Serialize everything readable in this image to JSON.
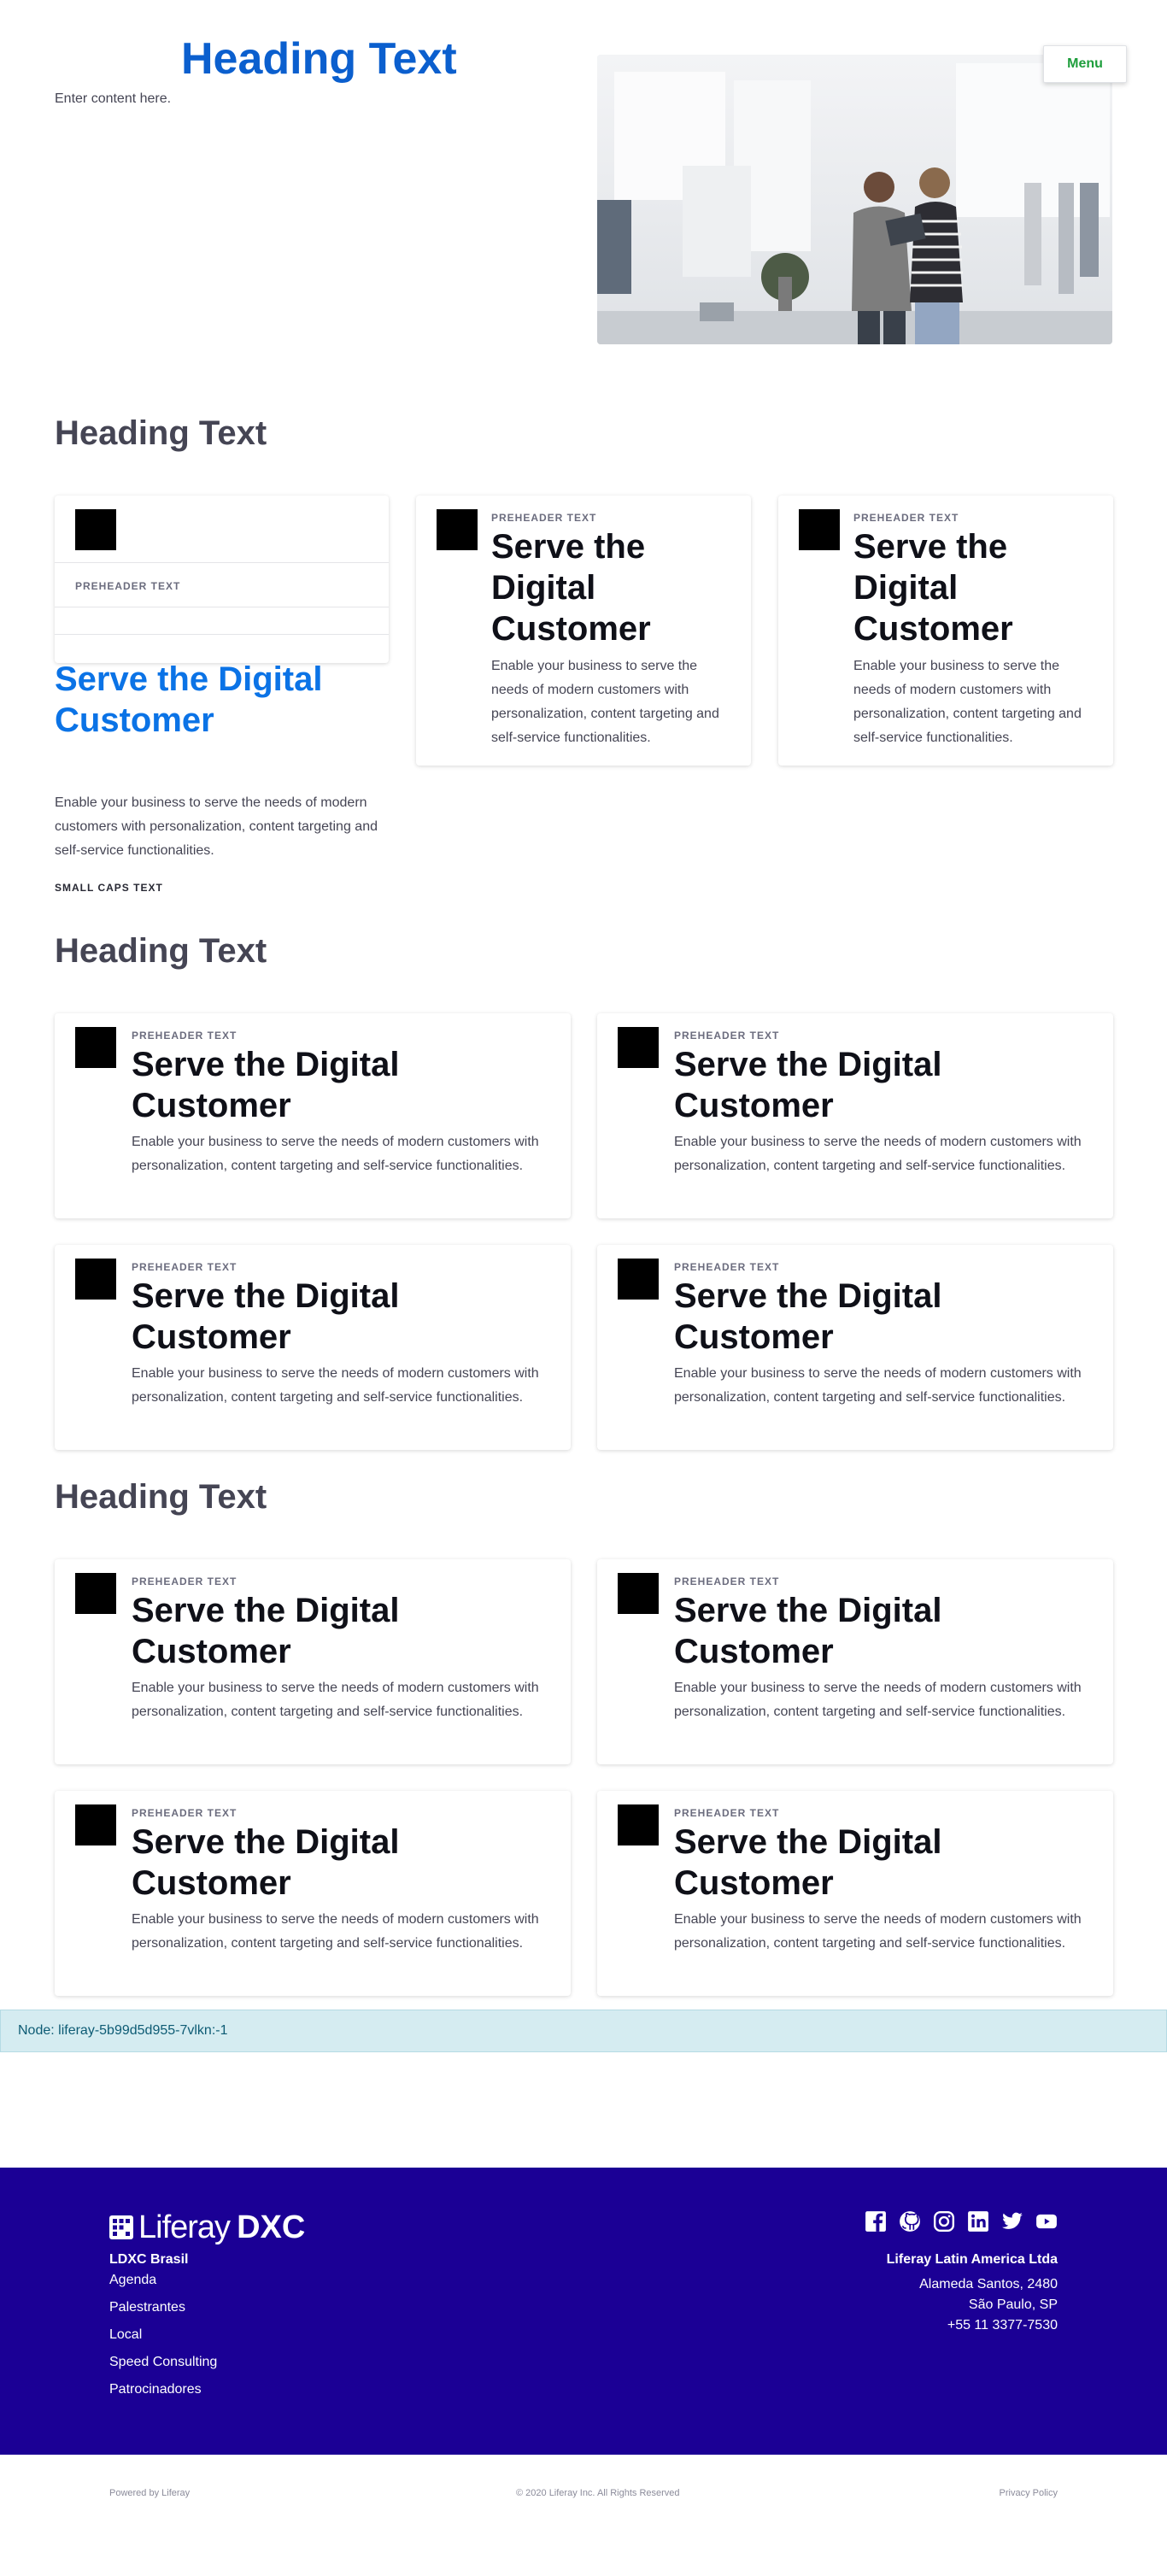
{
  "hero": {
    "heading": "Heading Text",
    "subtext": "Enter content here.",
    "menu_label": "Menu"
  },
  "sections": [
    {
      "heading": "Heading Text"
    },
    {
      "heading": "Heading Text"
    },
    {
      "heading": "Heading Text"
    }
  ],
  "featured": {
    "preheader": "PREHEADER TEXT",
    "title": "Serve the Digital Customer",
    "text": "Enable your business to serve the needs of modern customers with personalization, content targeting and self-service functionalities.",
    "small_caps": "SMALL CAPS TEXT"
  },
  "card": {
    "preheader": "PREHEADER TEXT",
    "title": "Serve the Digital Customer",
    "text": "Enable your business to serve the needs of modern customers with personalization, content targeting and self-service functionalities."
  },
  "node": "Node: liferay-5b99d5d955-7vlkn:-1",
  "footer": {
    "logo_primary": "Liferay",
    "logo_secondary": "DXC",
    "brand": "LDXC Brasil",
    "links": [
      "Agenda",
      "Palestrantes",
      "Local",
      "Speed Consulting",
      "Patrocinadores"
    ],
    "social": [
      "facebook-icon",
      "github-icon",
      "instagram-icon",
      "linkedin-icon",
      "twitter-icon",
      "youtube-icon"
    ],
    "company": "Liferay Latin America Ltda",
    "address1": "Alameda Santos, 2480",
    "address2": "São Paulo, SP",
    "phone": "+55 11 3377-7530",
    "bg_color": "#1b0095"
  },
  "bottom": {
    "powered": "Powered by Liferay",
    "copyright": "© 2020 Liferay Inc. All Rights Reserved",
    "privacy": "Privacy Policy"
  }
}
